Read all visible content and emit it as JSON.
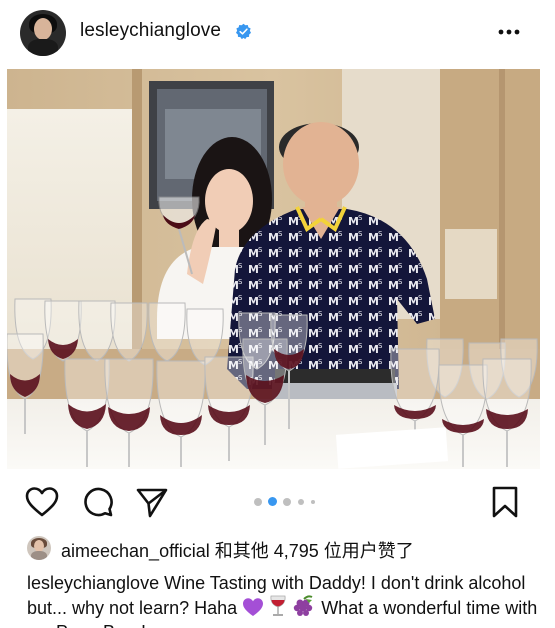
{
  "post": {
    "username": "lesleychianglove",
    "verified": true,
    "more_icon": "more-horizontal-icon"
  },
  "photo": {
    "carousel_total": 5,
    "carousel_active": 2
  },
  "actions": {
    "like_icon": "heart-icon",
    "comment_icon": "comment-icon",
    "share_icon": "send-icon",
    "save_icon": "bookmark-icon"
  },
  "likes": {
    "liked_by": "aimeechan_official",
    "suffix": " 和其他 4,795 位用户赞了"
  },
  "caption": {
    "username": "lesleychianglove",
    "text": " Wine Tasting with Daddy! I don't drink alcohol but... why not learn? Haha ",
    "after_emojis": " What a wonderful time with my Papa Bear!",
    "emojis": [
      "purple-heart-emoji",
      "wine-glass-emoji",
      "grapes-emoji"
    ]
  },
  "colors": {
    "text": "#111111",
    "verified_blue": "#3897f0",
    "dot_active": "#3897f0",
    "dot_inactive": "#bfbfbf"
  }
}
